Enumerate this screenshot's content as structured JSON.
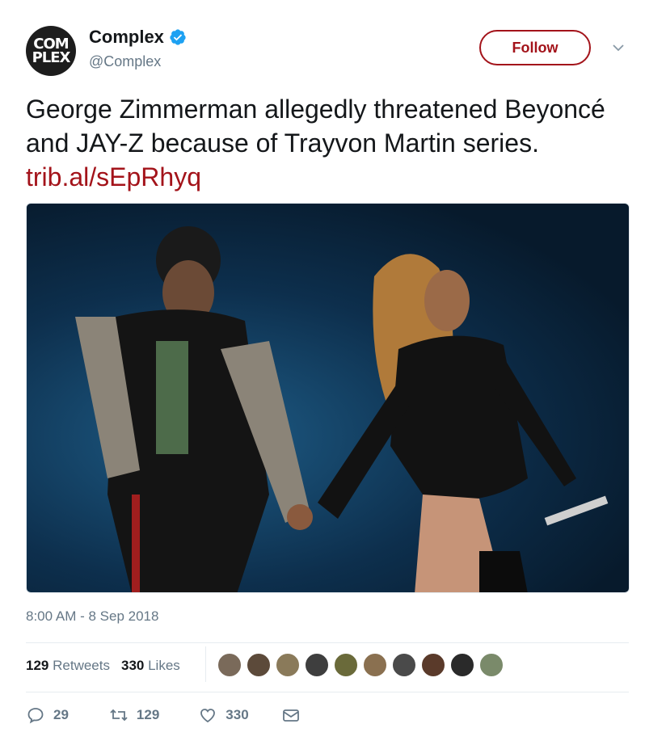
{
  "account": {
    "avatar_text_line1": "COM",
    "avatar_text_line2": "PLEX",
    "name": "Complex",
    "handle": "@Complex",
    "verified_icon": "verified-badge-icon"
  },
  "follow_label": "Follow",
  "tweet": {
    "text": "George Zimmerman allegedly threatened Beyoncé and JAY-Z because of Trayvon Martin series. ",
    "link": "trib.al/sEpRhyq",
    "timestamp": "8:00 AM - 8 Sep 2018"
  },
  "stats": {
    "retweets_count": "129",
    "retweets_label": "Retweets",
    "likes_count": "330",
    "likes_label": "Likes"
  },
  "likers": [
    "#7a6a5a",
    "#5c4a3a",
    "#8a7a5a",
    "#3e3e3e",
    "#6a6a3a",
    "#8a7050",
    "#4a4a4a",
    "#5a3a2a",
    "#2a2a2a",
    "#7a8a6a"
  ],
  "actions": {
    "replies": "29",
    "retweets": "129",
    "likes": "330"
  },
  "colors": {
    "accent": "#a3131a",
    "muted": "#657786"
  }
}
